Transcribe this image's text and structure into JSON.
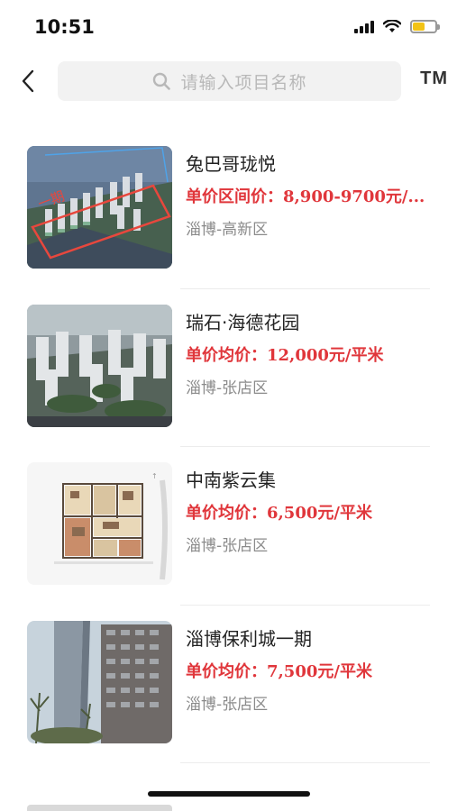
{
  "status_bar": {
    "time": "10:51",
    "battery_color": "#f2c316"
  },
  "header": {
    "back_icon": "chevron-left-icon",
    "search": {
      "placeholder": "请输入项目名称",
      "icon": "search-icon"
    },
    "tm_label": "TM"
  },
  "projects": [
    {
      "title": "兔巴哥珑悦",
      "price": "单价区间价：8,900-9700元/...",
      "location": "淄博-高新区",
      "thumb_annotation": "一期"
    },
    {
      "title": "瑞石·海德花园",
      "price": "单价均价：12,000元/平米",
      "location": "淄博-张店区"
    },
    {
      "title": "中南紫云集",
      "price": "单价均价：6,500元/平米",
      "location": "淄博-张店区"
    },
    {
      "title": "淄博保利城一期",
      "price": "单价均价：7,500元/平米",
      "location": "淄博-张店区"
    }
  ],
  "colors": {
    "price": "#e0363b",
    "search_bg": "#f2f2f2"
  }
}
